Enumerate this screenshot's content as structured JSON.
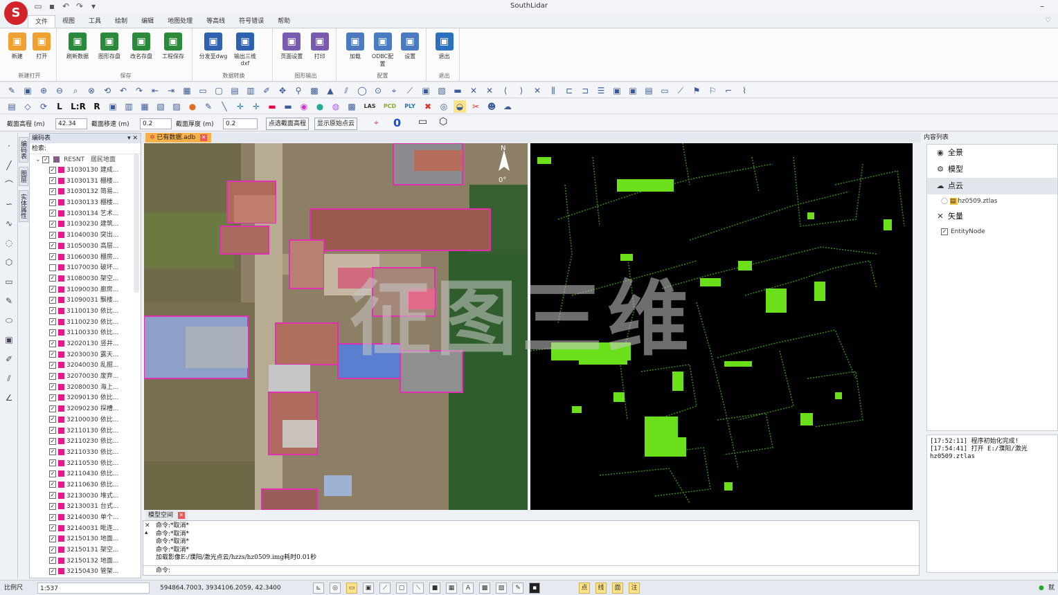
{
  "app": {
    "title": "SouthLidar",
    "menus": [
      "文件",
      "视图",
      "工具",
      "绘制",
      "编辑",
      "地图处理",
      "等高线",
      "符号错误",
      "帮助"
    ],
    "active_menu": 0
  },
  "ribbon": {
    "groups": [
      {
        "name": "新建打开",
        "buttons": [
          "新建",
          "打开"
        ]
      },
      {
        "name": "保存",
        "buttons": [
          "刷新数据",
          "图形存盘",
          "改名存盘",
          "工程保存"
        ]
      },
      {
        "name": "数据转换",
        "buttons": [
          "分发至dwg",
          "输出三维dxf"
        ]
      },
      {
        "name": "图形输出",
        "buttons": [
          "页面设置",
          "打印"
        ]
      },
      {
        "name": "配置",
        "buttons": [
          "加载",
          "ODBC配置",
          "设置"
        ]
      },
      {
        "name": "退出",
        "buttons": [
          "退出"
        ]
      }
    ]
  },
  "toolbar2_labels": {
    "l": "L",
    "lr": "L:R",
    "r": "R",
    "las": "LAS",
    "pcd": "PCD",
    "ply": "PLY"
  },
  "params": {
    "elev_label": "截面高程 (m)",
    "elev_value": "42.34",
    "move_label": "截面移速 (m)",
    "move_value": "0.2",
    "thick_label": "截面厚度 (m)",
    "thick_value": "0.2",
    "btn_pick": "点选截面高程",
    "btn_show": "显示原始点云",
    "zero": "0"
  },
  "codepanel": {
    "title": "编码表",
    "search_label": "检索:",
    "root_code": "RESNT",
    "root_name": "居民地面",
    "rows": [
      {
        "code": "31030130",
        "name": "建成...",
        "checked": true
      },
      {
        "code": "31030131",
        "name": "棚楼...",
        "checked": true
      },
      {
        "code": "31030132",
        "name": "简易...",
        "checked": true
      },
      {
        "code": "31030133",
        "name": "棚楼...",
        "checked": true
      },
      {
        "code": "31030134",
        "name": "艺术...",
        "checked": true
      },
      {
        "code": "31030230",
        "name": "建筑...",
        "checked": true
      },
      {
        "code": "31040030",
        "name": "突出...",
        "checked": true
      },
      {
        "code": "31050030",
        "name": "高层...",
        "checked": true
      },
      {
        "code": "31060030",
        "name": "棚房...",
        "checked": true
      },
      {
        "code": "31070030",
        "name": "破坏...",
        "checked": false
      },
      {
        "code": "31080030",
        "name": "架空...",
        "checked": true
      },
      {
        "code": "31090030",
        "name": "廊房...",
        "checked": true
      },
      {
        "code": "31090031",
        "name": "飘楼...",
        "checked": true
      },
      {
        "code": "31100130",
        "name": "依比...",
        "checked": true
      },
      {
        "code": "31100230",
        "name": "依比...",
        "checked": true
      },
      {
        "code": "31100330",
        "name": "依比...",
        "checked": true
      },
      {
        "code": "32020130",
        "name": "竖井...",
        "checked": true
      },
      {
        "code": "32030030",
        "name": "露天...",
        "checked": true
      },
      {
        "code": "32040030",
        "name": "乱掘...",
        "checked": true
      },
      {
        "code": "32070030",
        "name": "废弃...",
        "checked": true
      },
      {
        "code": "32080030",
        "name": "海上...",
        "checked": true
      },
      {
        "code": "32090130",
        "name": "依比...",
        "checked": true
      },
      {
        "code": "32090230",
        "name": "探槽...",
        "checked": true
      },
      {
        "code": "32100030",
        "name": "依比...",
        "checked": true
      },
      {
        "code": "32110130",
        "name": "依比...",
        "checked": true
      },
      {
        "code": "32110230",
        "name": "依比...",
        "checked": true
      },
      {
        "code": "32110330",
        "name": "依比...",
        "checked": true
      },
      {
        "code": "32110530",
        "name": "依比...",
        "checked": true
      },
      {
        "code": "32110430",
        "name": "依比...",
        "checked": true
      },
      {
        "code": "32110630",
        "name": "依比...",
        "checked": true
      },
      {
        "code": "32130030",
        "name": "堆式...",
        "checked": true
      },
      {
        "code": "32130031",
        "name": "台式...",
        "checked": true
      },
      {
        "code": "32140030",
        "name": "单个...",
        "checked": true
      },
      {
        "code": "32140031",
        "name": "毗连...",
        "checked": true
      },
      {
        "code": "32150130",
        "name": "地面...",
        "checked": true
      },
      {
        "code": "32150131",
        "name": "架空...",
        "checked": true
      },
      {
        "code": "32150132",
        "name": "地面...",
        "checked": true
      },
      {
        "code": "32150430",
        "name": "管架...",
        "checked": true
      }
    ]
  },
  "vtabs": [
    "编码表",
    "图层",
    "实体属性"
  ],
  "view": {
    "tab_label": "已有数据.adb",
    "north": "N",
    "north_angle": "0°",
    "watermark": "征图三维"
  },
  "console": {
    "tab_label": "模型空间",
    "lines": [
      "命令:*取消*",
      "命令:*取消*",
      "命令:*取消*",
      "命令:*取消*",
      "加载影像E:/濮阳/激光点云/hzzs/hz0509.img耗时0.01秒"
    ],
    "prompt": "命令:"
  },
  "rightpanel": {
    "title": "内容列表",
    "items": [
      {
        "label": "全景",
        "icon": "eye-icon"
      },
      {
        "label": "模型",
        "icon": "model-icon"
      },
      {
        "label": "点云",
        "icon": "cloud-icon",
        "selected": true
      },
      {
        "label": "矢量",
        "icon": "vector-icon"
      }
    ],
    "pointcloud_file": "hz0509.ztlas",
    "vector_child": "EntityNode",
    "log": [
      "[17:52:11] 程序初始化完成!",
      "[17:54:41] 打开 E:/濮阳/激光",
      "hz0509.ztlas"
    ]
  },
  "status": {
    "scale_label": "比例尺",
    "scale_value": "1:537",
    "coords": "594864.7003, 3934106.2059, 42.3400",
    "mode_buttons": [
      "点",
      "线",
      "面",
      "注"
    ],
    "end_text": "就"
  }
}
